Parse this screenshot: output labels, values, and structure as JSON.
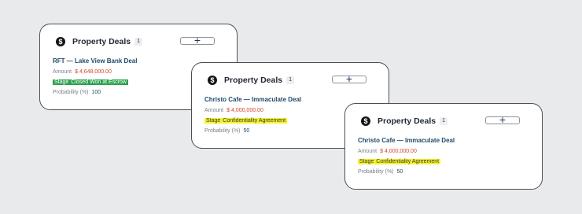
{
  "cards": [
    {
      "title": "Property Deals",
      "count": "1",
      "deal_name": "RFT — Lake View Bank Deal",
      "amount_label": "Amount",
      "amount_value": "$ 4,648,000.00",
      "stage_label": "Stage",
      "stage_value": "Closed Won at Escrow",
      "probability_label": "Probability (%)",
      "probability_value": "100",
      "stage_color": "#29a24b"
    },
    {
      "title": "Property Deals",
      "count": "1",
      "deal_name": "Christo Cafe — Immaculate Deal",
      "amount_label": "Amount",
      "amount_value": "$ 4,000,000.00",
      "stage_label": "Stage",
      "stage_value": "Confidentiality Agreement",
      "probability_label": "Probability (%)",
      "probability_value": "50",
      "stage_color": "#f4f22a"
    },
    {
      "title": "Property Deals",
      "count": "1",
      "deal_name": "Christo Cafe — Immaculate Deal",
      "amount_label": "Amount",
      "amount_value": "$ 4,000,000.00",
      "stage_label": "Stage",
      "stage_value": "Confidentiality Agreement",
      "probability_label": "Probability (%)",
      "probability_value": "50",
      "stage_color": "#f4f22a"
    }
  ],
  "icons": {
    "header": "dollar-icon",
    "add": "plus-icon"
  },
  "colors": {
    "amount": "#d2452c",
    "deal_name": "#1f4a6b",
    "background": "#e9eaec"
  }
}
